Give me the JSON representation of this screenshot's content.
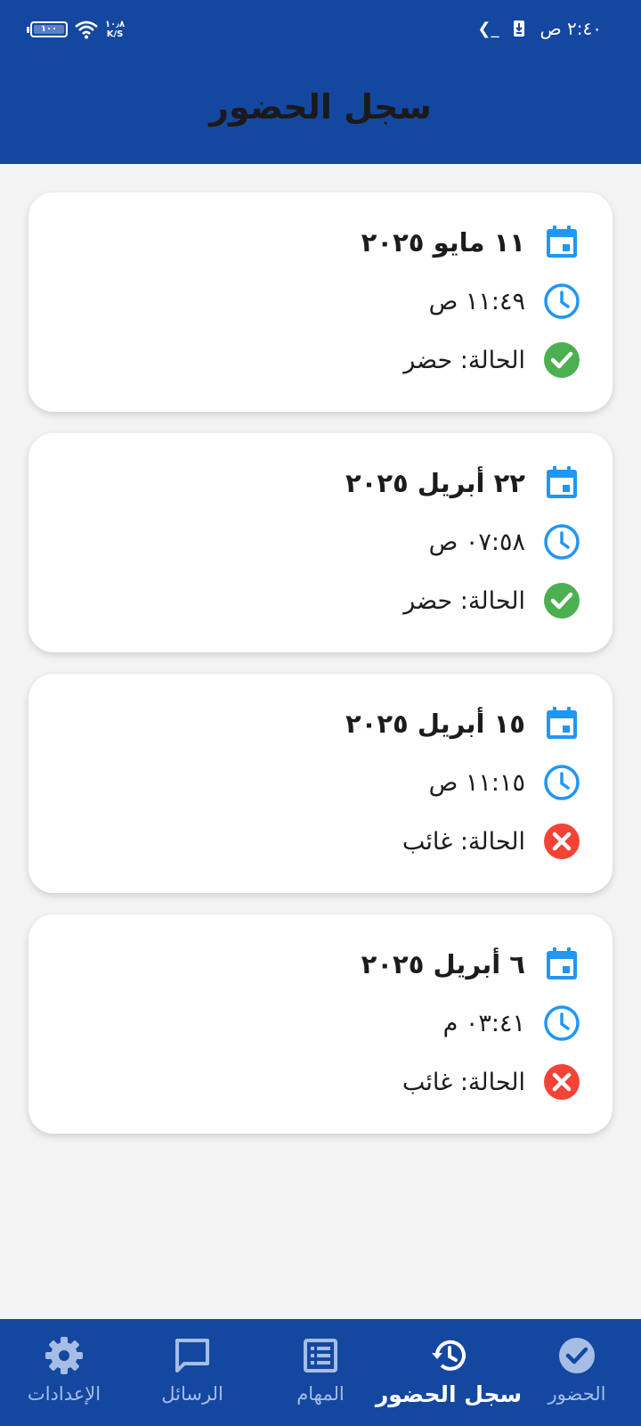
{
  "status_bar": {
    "time": "٢:٤٠ ص",
    "battery_level": "١٠٠",
    "net_speed_value": "١٠٫٨",
    "net_speed_unit": "K/S"
  },
  "header": {
    "title": "سجل الحضور"
  },
  "records": [
    {
      "date": "١١ مايو ٢٠٢٥",
      "time": "١١:٤٩ ص",
      "status": "الحالة: حضر",
      "status_kind": "present"
    },
    {
      "date": "٢٢ أبريل ٢٠٢٥",
      "time": "٠٧:٥٨ ص",
      "status": "الحالة: حضر",
      "status_kind": "present"
    },
    {
      "date": "١٥ أبريل ٢٠٢٥",
      "time": "١١:١٥ ص",
      "status": "الحالة: غائب",
      "status_kind": "absent"
    },
    {
      "date": "٦ أبريل ٢٠٢٥",
      "time": "٠٣:٤١ م",
      "status": "الحالة: غائب",
      "status_kind": "absent"
    }
  ],
  "icons": {
    "date": "calendar-icon",
    "time": "clock-icon",
    "present": "check-circle-icon",
    "absent": "cancel-circle-icon"
  },
  "colors": {
    "primary": "#1447a0",
    "accent_blue": "#2196f3",
    "present_green": "#4caf50",
    "absent_red": "#f44336",
    "nav_inactive": "#a6bde6"
  },
  "bottom_nav": {
    "attendance": "الحضور",
    "attendance_log": "سجل الحضور",
    "tasks": "المهام",
    "messages": "الرسائل",
    "settings": "الإعدادات",
    "active": "attendance_log"
  }
}
